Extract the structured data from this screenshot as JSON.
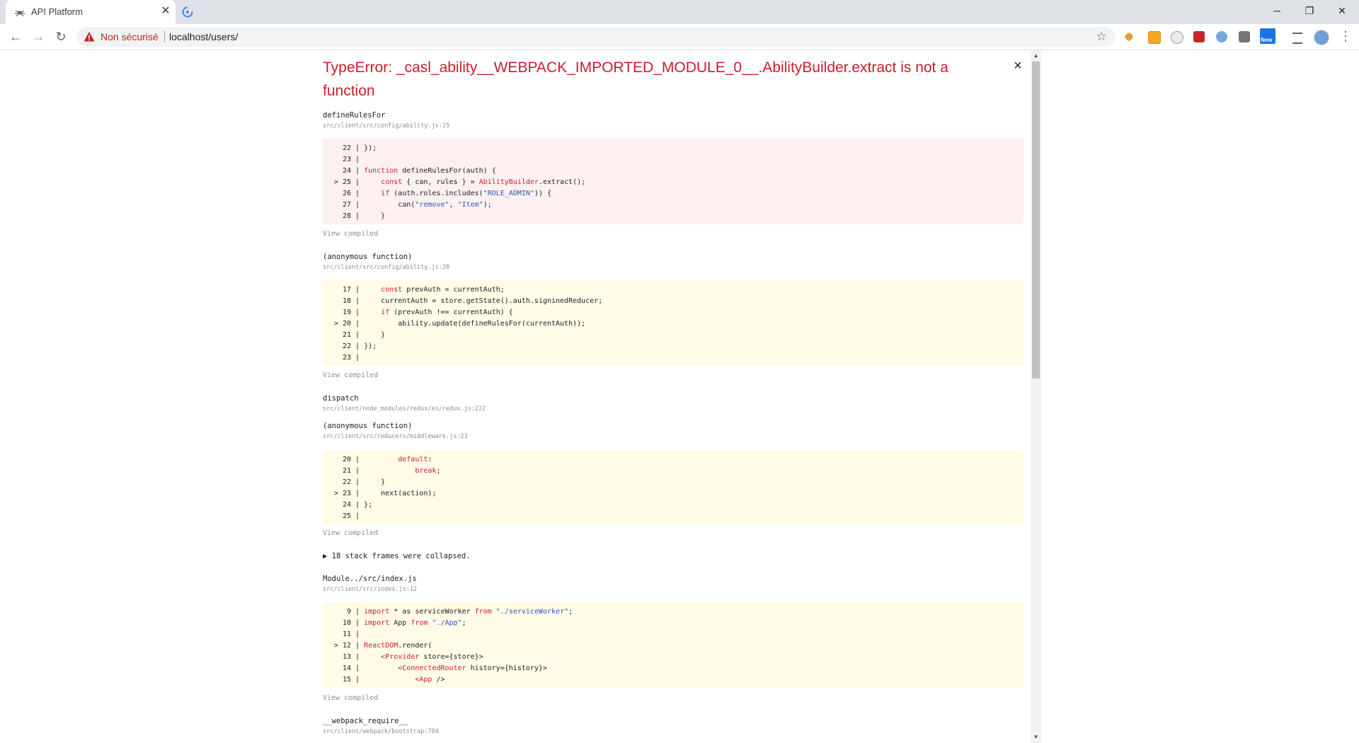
{
  "browser": {
    "tab_title": "API Platform",
    "window_controls": {
      "minimize": "─",
      "maximize": "❐",
      "close": "✕"
    },
    "security_label": "Non sécurisé",
    "url": "localhost/users/",
    "extensions": [
      "react-devtools-icon",
      "honey-icon",
      "timer-icon",
      "redux-icon",
      "compass-icon",
      "camera-icon",
      "new-extension-icon"
    ],
    "new_badge": "New"
  },
  "error": {
    "title": "TypeError: _casl_ability__WEBPACK_IMPORTED_MODULE_0__.AbilityBuilder.extract is not a function",
    "close_label": "×",
    "view_compiled_label": "View compiled",
    "collapsed_label": "▶ 18 stack frames were collapsed.",
    "frames": [
      {
        "fn": "defineRulesFor",
        "loc": "src/client/src/config/ability.js:25"
      },
      {
        "fn": "(anonymous function)",
        "loc": "src/client/src/config/ability.js:20"
      },
      {
        "fn": "dispatch",
        "loc": "src/client/node_modules/redux/es/redux.js:222"
      },
      {
        "fn": "(anonymous function)",
        "loc": "src/client/src/reducers/middleware.js:23"
      },
      {
        "fn": "Module../src/index.js",
        "loc": "src/client/src/index.js:12"
      },
      {
        "fn": "__webpack_require__",
        "loc": "src/client/webpack/bootstrap:784"
      }
    ],
    "code_blocks": [
      [
        {
          "num": "22",
          "mark": "",
          "text": "});"
        },
        {
          "num": "23",
          "mark": "",
          "text": ""
        },
        {
          "num": "24",
          "mark": "",
          "text": "function defineRulesFor(auth) {"
        },
        {
          "num": "25",
          "mark": ">",
          "text": "    const { can, rules } = AbilityBuilder.extract();"
        },
        {
          "num": "26",
          "mark": "",
          "text": "    if (auth.roles.includes(\"ROLE_ADMIN\")) {"
        },
        {
          "num": "27",
          "mark": "",
          "text": "        can(\"remove\", \"Item\");"
        },
        {
          "num": "28",
          "mark": "",
          "text": "    }"
        }
      ],
      [
        {
          "num": "17",
          "mark": "",
          "text": "    const prevAuth = currentAuth;"
        },
        {
          "num": "18",
          "mark": "",
          "text": "    currentAuth = store.getState().auth.signinedReducer;"
        },
        {
          "num": "19",
          "mark": "",
          "text": "    if (prevAuth !== currentAuth) {"
        },
        {
          "num": "20",
          "mark": ">",
          "text": "        ability.update(defineRulesFor(currentAuth));"
        },
        {
          "num": "21",
          "mark": "",
          "text": "    }"
        },
        {
          "num": "22",
          "mark": "",
          "text": "});"
        },
        {
          "num": "23",
          "mark": "",
          "text": ""
        }
      ],
      [
        {
          "num": "20",
          "mark": "",
          "text": "        default:"
        },
        {
          "num": "21",
          "mark": "",
          "text": "            break;"
        },
        {
          "num": "22",
          "mark": "",
          "text": "    }"
        },
        {
          "num": "23",
          "mark": ">",
          "text": "    next(action);"
        },
        {
          "num": "24",
          "mark": "",
          "text": "};"
        },
        {
          "num": "25",
          "mark": "",
          "text": ""
        }
      ],
      [
        {
          "num": "9",
          "mark": "",
          "text": "import * as serviceWorker from \"./serviceWorker\";"
        },
        {
          "num": "10",
          "mark": "",
          "text": "import App from \"./App\";"
        },
        {
          "num": "11",
          "mark": "",
          "text": ""
        },
        {
          "num": "12",
          "mark": ">",
          "text": "ReactDOM.render("
        },
        {
          "num": "13",
          "mark": "",
          "text": "    <Provider store={store}>"
        },
        {
          "num": "14",
          "mark": "",
          "text": "        <ConnectedRouter history={history}>"
        },
        {
          "num": "15",
          "mark": "",
          "text": "            <App />"
        }
      ]
    ]
  },
  "colors": {
    "error_red": "#c91d2e",
    "insecure_red": "#c5221f",
    "red_block_bg": "#fcf0f1",
    "yellow_block_bg": "#fffbe6",
    "muted": "#878e91",
    "string_blue": "#2f55b5"
  }
}
